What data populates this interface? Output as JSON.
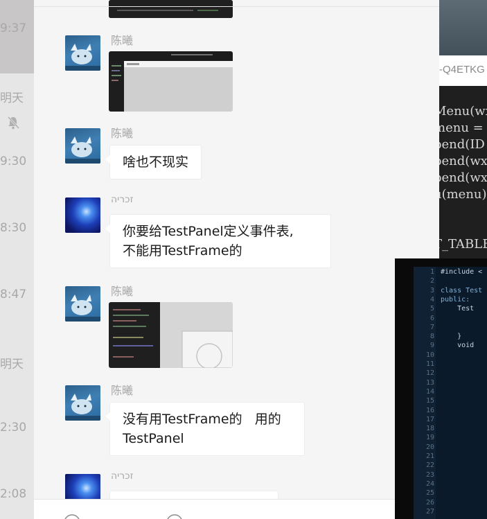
{
  "session_list": {
    "items": [
      {
        "time": "9:37"
      },
      {
        "time": "明天"
      },
      {
        "time": "9:30"
      },
      {
        "time": "8:30"
      },
      {
        "time": "8:47"
      },
      {
        "time": "明天"
      },
      {
        "time": "2:30"
      },
      {
        "time": "2:08"
      }
    ]
  },
  "chat": {
    "messages": [
      {
        "sender": "陈曦",
        "type": "image"
      },
      {
        "sender": "陈曦",
        "type": "text",
        "text": "啥也不现实"
      },
      {
        "sender": "זכריה",
        "type": "text",
        "text": "你要给TestPanel定义事件表,\n不能用TestFrame的"
      },
      {
        "sender": "陈曦",
        "type": "image"
      },
      {
        "sender": "陈曦",
        "type": "text",
        "text": "没有用TestFrame的   用的\nTestPanel"
      },
      {
        "sender": "זכריה",
        "type": "text",
        "text": ""
      }
    ]
  },
  "background_window": {
    "title": "-Q4ETKG",
    "code_lines": [
      "Menu(wx",
      "menu = ",
      "pend(ID",
      "pend(wx",
      "pend(wx",
      "u(menu)",
      "",
      "",
      "T_TABLE"
    ]
  },
  "editor": {
    "line_numbers": [
      "1",
      "2",
      "3",
      "4",
      "5",
      "6",
      "7",
      "8",
      "9",
      "10",
      "11",
      "12",
      "13",
      "14",
      "15",
      "16",
      "17",
      "18",
      "19",
      "20",
      "21",
      "22",
      "23",
      "24",
      "25",
      "26",
      "27"
    ],
    "lines": [
      "#include <",
      "",
      "class Test",
      "public:",
      "    Test",
      "",
      "",
      "    }",
      "    void"
    ]
  },
  "colors": {
    "chat_bg": "#f5f5f5",
    "bubble_bg": "#ffffff",
    "sender_name": "#a8a8a8",
    "session_list_bg": "#e6e6e6"
  }
}
